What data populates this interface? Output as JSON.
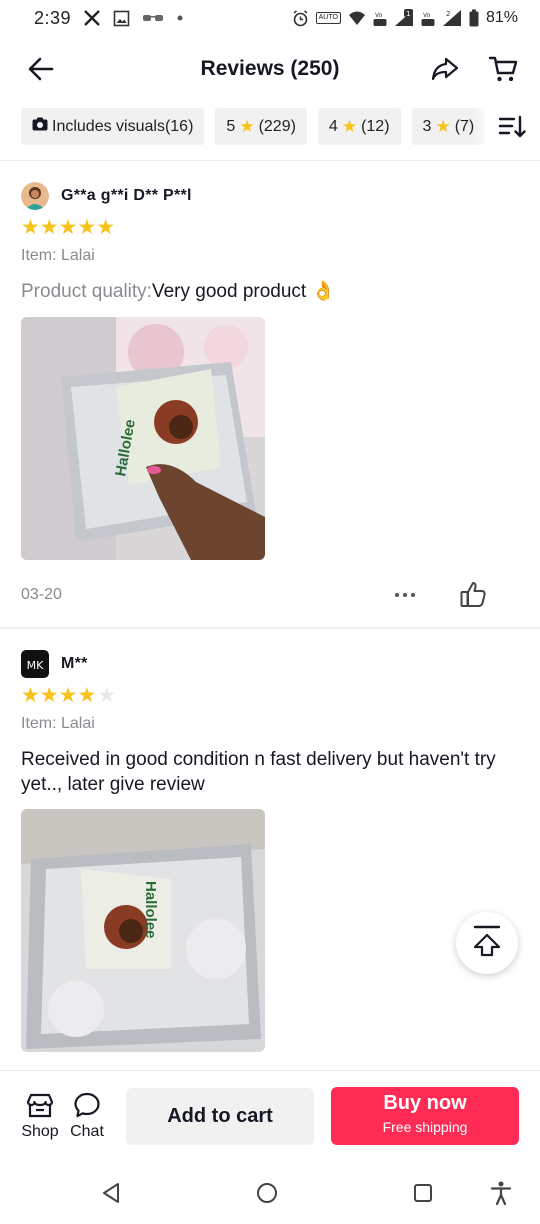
{
  "status_bar": {
    "time": "2:39",
    "battery": "81%",
    "icons": [
      "x-icon",
      "gallery-icon",
      "glasses-icon",
      "dot-icon",
      "alarm-icon",
      "auto-icon",
      "wifi-icon",
      "volte-icon",
      "signal-icon",
      "volte-icon",
      "signal-icon",
      "battery-icon"
    ],
    "network_badge_1": "1",
    "network_badge_2": "2"
  },
  "header": {
    "title": "Reviews (250)",
    "icons": [
      "back-arrow-icon",
      "share-icon",
      "cart-icon"
    ]
  },
  "filters": [
    {
      "icon": "camera-icon",
      "label": "Includes visuals(16)"
    },
    {
      "rating": "5",
      "count": "(229)"
    },
    {
      "rating": "4",
      "count": "(12)"
    },
    {
      "rating": "3",
      "count": "(7)"
    }
  ],
  "reviews": [
    {
      "reviewer": "G**a g**i D** P**l",
      "rating": 5,
      "stars_text": "★★★★★",
      "stars_off_text": "",
      "item": "Item: Lalai",
      "quality_label": "Product quality:",
      "quality_value": "Very good product 👌",
      "date": "03-20",
      "photo_label": "Hallolee"
    },
    {
      "reviewer": "M**",
      "avatar_text": "MK",
      "rating": 4,
      "stars_text": "★★★★",
      "stars_off_text": "★",
      "item": "Item: Lalai",
      "text": "Received in good condition n fast delivery but haven't try yet.., later give review",
      "photo_label": "Hallolee"
    }
  ],
  "action_bar": {
    "shop_label": "Shop",
    "chat_label": "Chat",
    "add_to_cart": "Add to cart",
    "buy_now": "Buy now",
    "free_shipping": "Free shipping",
    "colors": {
      "buy_now_bg": "#fe2c55",
      "add_cart_bg": "#f1f1f2",
      "star": "#f7c31a"
    }
  },
  "nav_bar": {
    "icons": [
      "back-nav-icon",
      "home-nav-icon",
      "recents-nav-icon",
      "accessibility-icon"
    ]
  }
}
